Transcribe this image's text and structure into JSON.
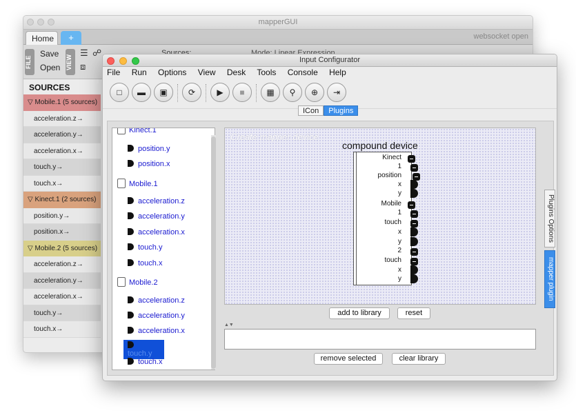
{
  "back_window": {
    "title": "mapperGUI",
    "tabs": {
      "home": "Home",
      "add": "+"
    },
    "status": "websocket open",
    "ribbon": {
      "file_label": "FILE",
      "save": "Save",
      "open": "Open",
      "view_label": "VIEW",
      "sources_label": "Sources:",
      "mode_label": "Mode:  Linear  Expression"
    },
    "sources_header": "SOURCES",
    "groups": [
      {
        "label": "▽ Mobile.1 (5 sources)",
        "color": "#d98c8c",
        "items": [
          "acceleration.z→",
          "acceleration.y→",
          "acceleration.x→",
          "touch.y→",
          "touch.x→"
        ]
      },
      {
        "label": "▽ Kinect.1 (2 sources)",
        "color": "#d9a27d",
        "items": [
          "position.y→",
          "position.x→"
        ]
      },
      {
        "label": "▽ Mobile.2 (5 sources)",
        "color": "#d8cf8a",
        "items": [
          "acceleration.z→",
          "acceleration.y→",
          "acceleration.x→",
          "touch.y→",
          "touch.x→"
        ]
      }
    ]
  },
  "front_window": {
    "title": "Input Configurator",
    "menu": [
      "File",
      "Run",
      "Options",
      "View",
      "Desk",
      "Tools",
      "Console",
      "Help"
    ],
    "mode_tabs": {
      "icon": "ICon",
      "plugins": "Plugins"
    },
    "tree": {
      "kinect": "Kinect.1",
      "kinect_items": [
        "position.y",
        "position.x"
      ],
      "mobile1": "Mobile.1",
      "mobile1_items": [
        "acceleration.z",
        "acceleration.y",
        "acceleration.x",
        "touch.y",
        "touch.x"
      ],
      "mobile2": "Mobile.2",
      "mobile2_items": [
        "acceleration.z",
        "acceleration.y",
        "acceleration.x",
        "touch.y",
        "touch.x"
      ]
    },
    "canvas": {
      "placeholder": "Create mapper device",
      "device_title": "compound device",
      "ports": [
        "Kinect",
        "1",
        "position",
        "x",
        "y",
        "Mobile",
        "1",
        "touch",
        "x",
        "y",
        "2",
        "touch",
        "x",
        "y"
      ]
    },
    "buttons": {
      "add": "add to library",
      "reset": "reset",
      "remove": "remove selected",
      "clear": "clear library"
    },
    "side_tabs": {
      "options": "Plugins Options",
      "mapper": "mapper plugin"
    }
  }
}
